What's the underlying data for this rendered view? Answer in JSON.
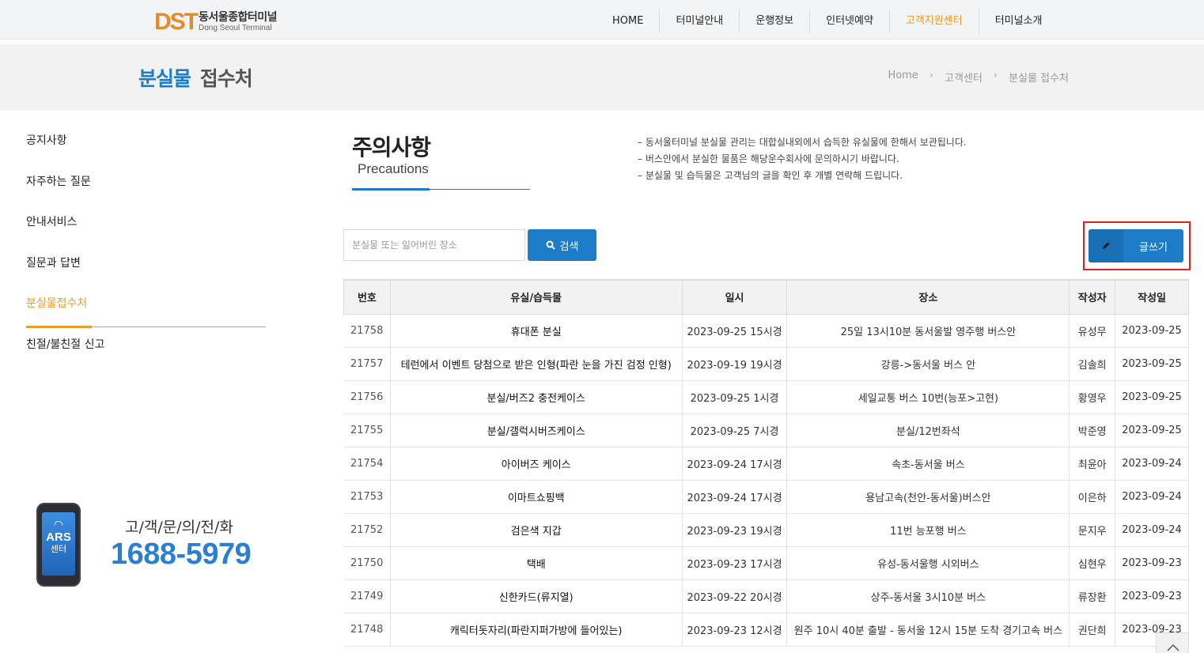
{
  "header": {
    "logo_mark": "DST",
    "logo_ko": "동서울종합터미널",
    "logo_en": "Dong Seoul Terminal",
    "nav": [
      {
        "label": "HOME"
      },
      {
        "label": "터미널안내"
      },
      {
        "label": "운행정보"
      },
      {
        "label": "인터넷예약"
      },
      {
        "label": "고객지원센터"
      },
      {
        "label": "터미널소개"
      }
    ],
    "active_index": 4,
    "accent_color": "#e99b2e"
  },
  "title_bar": {
    "title_highlight": "분실물",
    "title_rest": "접수처",
    "breadcrumb": [
      "Home",
      "고객센터",
      "분실물 접수처"
    ]
  },
  "sidebar": {
    "items": [
      {
        "label": "공지사항"
      },
      {
        "label": "자주하는 질문"
      },
      {
        "label": "안내서비스"
      },
      {
        "label": "질문과 답변"
      },
      {
        "label": "분실물접수처"
      },
      {
        "label": "친절/불친절 신고"
      }
    ],
    "active_index": 4,
    "ars": {
      "screen_ars": "ARS",
      "screen_center": "센터",
      "label": "고/객/문/의/전/화",
      "number": "1688-5979"
    }
  },
  "precautions": {
    "title_ko": "주의사항",
    "title_en": "Precautions",
    "notes": [
      "동서울터미널 분실물 관리는 대합실내외에서 습득한 유실물에 한해서 보관됩니다.",
      "버스안에서 분실한 물품은 해당운수회사에 문의하시기 바랍니다.",
      "분실물 및 습득물은 고객님의 글을 확인 후 개별 연락해 드립니다."
    ]
  },
  "search": {
    "placeholder": "분실물 또는 잃어버린 장소",
    "button_label": "검색"
  },
  "write_button": {
    "label": "글쓰기"
  },
  "board": {
    "columns": [
      "번호",
      "유실/습득물",
      "일시",
      "장소",
      "작성자",
      "작성일"
    ],
    "rows": [
      {
        "no": "21758",
        "item": "휴대폰 분실",
        "datetime": "2023-09-25 15시경",
        "place": "25일 13시10분 동서울발 영주행 버스안",
        "writer": "유성무",
        "date": "2023-09-25"
      },
      {
        "no": "21757",
        "item": "테런에서 이벤트 당첨으로 받은 인형(파란 눈을 가진 검정 인형)",
        "datetime": "2023-09-19 19시경",
        "place": "강릉->동서울 버스 안",
        "writer": "김솔희",
        "date": "2023-09-25"
      },
      {
        "no": "21756",
        "item": "분실/버즈2 충전케이스",
        "datetime": "2023-09-25 1시경",
        "place": "세일교통 버스 10번(능포>고현)",
        "writer": "황영우",
        "date": "2023-09-25"
      },
      {
        "no": "21755",
        "item": "분실/갤럭시버즈케이스",
        "datetime": "2023-09-25 7시경",
        "place": "분실/12번좌석",
        "writer": "박준영",
        "date": "2023-09-25"
      },
      {
        "no": "21754",
        "item": "아이버즈 케이스",
        "datetime": "2023-09-24 17시경",
        "place": "속초-동서울 버스",
        "writer": "최윤아",
        "date": "2023-09-24"
      },
      {
        "no": "21753",
        "item": "이마트쇼핑백",
        "datetime": "2023-09-24 17시경",
        "place": "용남고속(천안-동서울)버스안",
        "writer": "이은하",
        "date": "2023-09-24"
      },
      {
        "no": "21752",
        "item": "검은색 지갑",
        "datetime": "2023-09-23 19시경",
        "place": "11번 능포행 버스",
        "writer": "문지우",
        "date": "2023-09-24"
      },
      {
        "no": "21750",
        "item": "택배",
        "datetime": "2023-09-23 17시경",
        "place": "유성-동서울행 시외버스",
        "writer": "심현우",
        "date": "2023-09-23"
      },
      {
        "no": "21749",
        "item": "신한카드(류지열)",
        "datetime": "2023-09-22 20시경",
        "place": "상주-동서울 3시10분 버스",
        "writer": "류장환",
        "date": "2023-09-23"
      },
      {
        "no": "21748",
        "item": "캐릭터돗자리(파란지퍼가방에 들어있는)",
        "datetime": "2023-09-23 12시경",
        "place": "원주 10시 40분 출발 - 동서울 12시 15분 도착 경기고속 버스",
        "writer": "권단희",
        "date": "2023-09-23"
      }
    ]
  },
  "colors": {
    "primary": "#1c7cc7",
    "accent": "#e99b2e",
    "highlight_outline": "#e02020"
  }
}
